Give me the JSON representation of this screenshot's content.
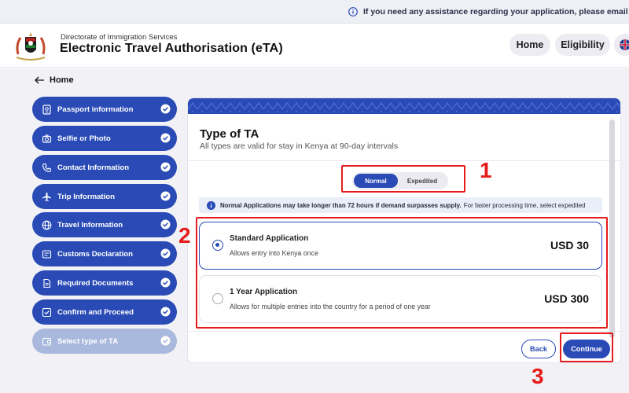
{
  "notice": {
    "text": "If you need any assistance regarding your application, please email us at: etak"
  },
  "header": {
    "org": "Directorate of Immigration Services",
    "title": "Electronic Travel Authorisation (eTA)",
    "home_label": "Home",
    "eligibility_label": "Eligibility"
  },
  "breadcrumb": {
    "back_label": "Home"
  },
  "sidebar": {
    "items": [
      {
        "label": "Passport information",
        "icon": "passport-icon"
      },
      {
        "label": "Selfie or Photo",
        "icon": "camera-icon"
      },
      {
        "label": "Contact Information",
        "icon": "phone-icon"
      },
      {
        "label": "Trip Information",
        "icon": "plane-icon"
      },
      {
        "label": "Travel Information",
        "icon": "globe-icon"
      },
      {
        "label": "Customs Declaration",
        "icon": "customs-icon"
      },
      {
        "label": "Required Documents",
        "icon": "documents-icon"
      },
      {
        "label": "Confirm and Proceed",
        "icon": "checkbox-icon"
      },
      {
        "label": "Select type of TA",
        "icon": "wallet-icon"
      }
    ]
  },
  "main": {
    "title": "Type of TA",
    "subtitle": "All types are valid for stay in Kenya at 90-day intervals",
    "toggle": {
      "normal": "Normal",
      "expedited": "Expedited"
    },
    "info": {
      "bold": "Normal Applications may take longer than 72 hours if demand surpasses supply.",
      "rest": "For faster processing time, select expedited"
    },
    "options": [
      {
        "name": "Standard Application",
        "desc": "Allows entry into Kenya once",
        "price": "USD 30"
      },
      {
        "name": "1 Year Application",
        "desc": "Allows for multiple entries into the country for a period of one year",
        "price": "USD 300"
      }
    ],
    "back_label": "Back",
    "continue_label": "Continue"
  },
  "annotations": {
    "one": "1",
    "two": "2",
    "three": "3"
  },
  "colors": {
    "primary": "#2a4bb6",
    "annotation": "#e51c1c"
  }
}
